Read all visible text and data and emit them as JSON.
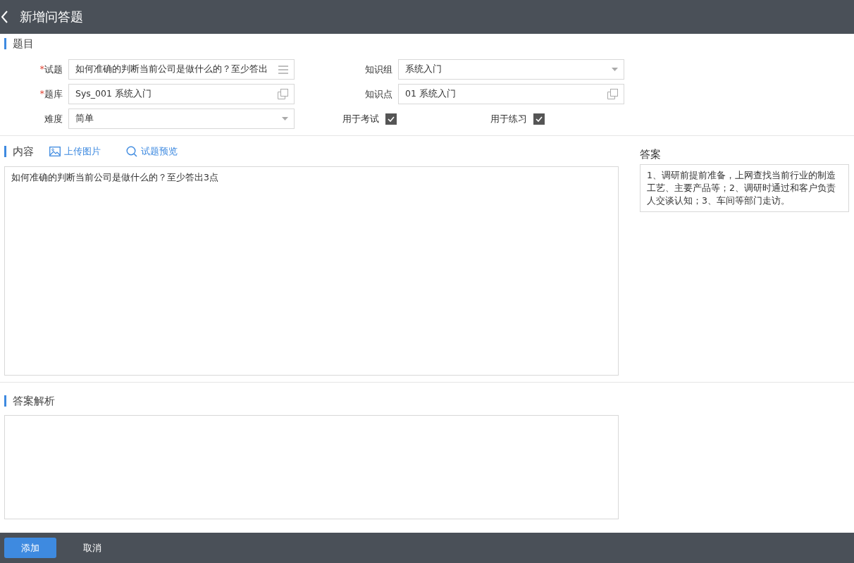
{
  "header": {
    "title": "新增问答题"
  },
  "question_section": {
    "title": "题目",
    "required_symbol": "*",
    "left_fields": [
      {
        "label": "试题",
        "required": true,
        "value": "如何准确的判断当前公司是做什么的？至少答出",
        "kind": "menu"
      },
      {
        "label": "题库",
        "required": true,
        "value": "Sys_001 系统入门",
        "kind": "lookup"
      },
      {
        "label": "难度",
        "required": false,
        "value": "简单",
        "kind": "select"
      }
    ],
    "right_fields": [
      {
        "label": "知识组",
        "required": false,
        "value": "系统入门",
        "kind": "select"
      },
      {
        "label": "知识点",
        "required": false,
        "value": "01 系统入门",
        "kind": "lookup"
      }
    ],
    "checkboxes": [
      {
        "label": "用于考试",
        "checked": true
      },
      {
        "label": "用于练习",
        "checked": true
      }
    ]
  },
  "content_section": {
    "title": "内容",
    "actions": [
      {
        "label": "上传图片",
        "kind": "image"
      },
      {
        "label": "试题预览",
        "kind": "search"
      }
    ],
    "value": "如何准确的判断当前公司是做什么的？至少答出3点"
  },
  "answer": {
    "title": "答案",
    "value": "1、调研前提前准备，上网查找当前行业的制造工艺、主要产品等；2、调研时通过和客户负责人交谈认知；3、车间等部门走访。"
  },
  "analysis_section": {
    "title": "答案解析"
  },
  "footer": {
    "buttons": [
      {
        "label": "添加",
        "kind": "primary"
      },
      {
        "label": "取消",
        "kind": "plain"
      }
    ]
  }
}
